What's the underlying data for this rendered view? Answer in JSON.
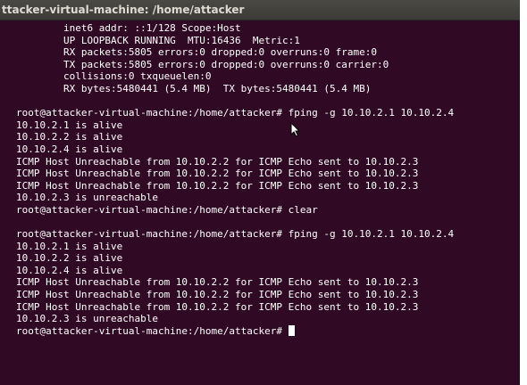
{
  "window": {
    "title": "ttacker-virtual-machine: /home/attacker"
  },
  "terminal": {
    "lines": [
      "        inet6 addr: ::1/128 Scope:Host",
      "        UP LOOPBACK RUNNING  MTU:16436  Metric:1",
      "        RX packets:5805 errors:0 dropped:0 overruns:0 frame:0",
      "        TX packets:5805 errors:0 dropped:0 overruns:0 carrier:0",
      "        collisions:0 txqueuelen:0",
      "        RX bytes:5480441 (5.4 MB)  TX bytes:5480441 (5.4 MB)",
      "",
      "root@attacker-virtual-machine:/home/attacker# fping -g 10.10.2.1 10.10.2.4",
      "10.10.2.1 is alive",
      "10.10.2.2 is alive",
      "10.10.2.4 is alive",
      "ICMP Host Unreachable from 10.10.2.2 for ICMP Echo sent to 10.10.2.3",
      "ICMP Host Unreachable from 10.10.2.2 for ICMP Echo sent to 10.10.2.3",
      "ICMP Host Unreachable from 10.10.2.2 for ICMP Echo sent to 10.10.2.3",
      "10.10.2.3 is unreachable",
      "root@attacker-virtual-machine:/home/attacker# clear",
      "",
      "root@attacker-virtual-machine:/home/attacker# fping -g 10.10.2.1 10.10.2.4",
      "10.10.2.1 is alive",
      "10.10.2.2 is alive",
      "10.10.2.4 is alive",
      "ICMP Host Unreachable from 10.10.2.2 for ICMP Echo sent to 10.10.2.3",
      "ICMP Host Unreachable from 10.10.2.2 for ICMP Echo sent to 10.10.2.3",
      "ICMP Host Unreachable from 10.10.2.2 for ICMP Echo sent to 10.10.2.3",
      "10.10.2.3 is unreachable"
    ],
    "prompt": "root@attacker-virtual-machine:/home/attacker# "
  },
  "colors": {
    "terminal_background": "#300a24",
    "terminal_foreground": "#ffffff",
    "titlebar_background": "#3c3b37",
    "title_text": "#dfdbd2"
  },
  "icons": {
    "mouse_pointer": "mouse-pointer-icon",
    "cursor": "text-cursor-icon"
  }
}
